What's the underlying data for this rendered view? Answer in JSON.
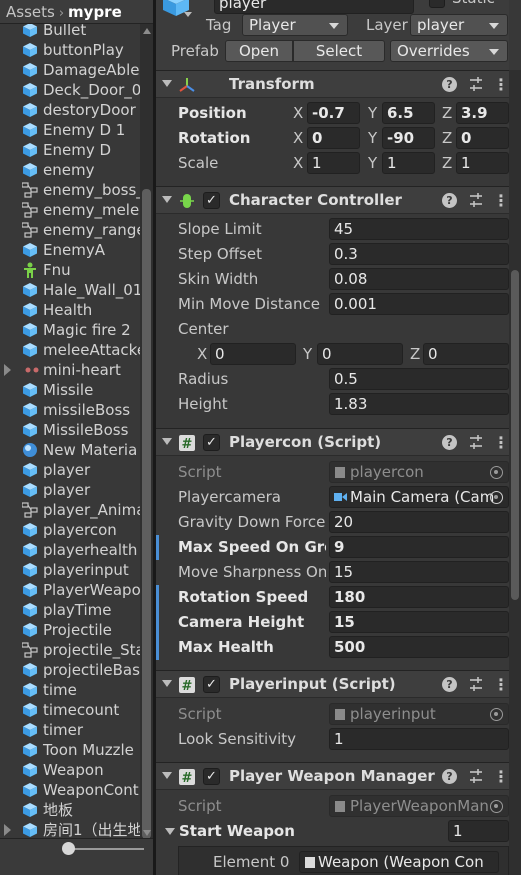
{
  "project": {
    "breadcrumb_root": "Assets",
    "breadcrumb_separator": "›",
    "breadcrumb_current": "mypre",
    "assets": [
      {
        "label": "Bullet",
        "icon": "prefab-icon"
      },
      {
        "label": "buttonPlay",
        "icon": "prefab-icon"
      },
      {
        "label": "DamageAble",
        "icon": "prefab-icon"
      },
      {
        "label": "Deck_Door_0",
        "icon": "prefab-icon"
      },
      {
        "label": "destoryDoor",
        "icon": "prefab-icon"
      },
      {
        "label": "Enemy D 1",
        "icon": "prefab-icon"
      },
      {
        "label": "Enemy D",
        "icon": "prefab-icon"
      },
      {
        "label": "enemy",
        "icon": "prefab-icon"
      },
      {
        "label": "enemy_boss_",
        "icon": "animator-icon"
      },
      {
        "label": "enemy_melee",
        "icon": "animator-icon"
      },
      {
        "label": "enemy_range",
        "icon": "animator-icon"
      },
      {
        "label": "EnemyA",
        "icon": "prefab-icon"
      },
      {
        "label": "Fnu",
        "icon": "avatar-mask-icon"
      },
      {
        "label": "Hale_Wall_01",
        "icon": "prefab-icon"
      },
      {
        "label": "Health",
        "icon": "prefab-icon"
      },
      {
        "label": "Magic fire 2",
        "icon": "prefab-icon"
      },
      {
        "label": "meleeAttacke",
        "icon": "prefab-icon"
      },
      {
        "label": "mini-heart",
        "icon": "heart-model-icon",
        "foldable": true
      },
      {
        "label": "Missile",
        "icon": "prefab-icon"
      },
      {
        "label": "missileBoss",
        "icon": "prefab-icon"
      },
      {
        "label": "MissileBoss",
        "icon": "prefab-icon"
      },
      {
        "label": "New Materia",
        "icon": "material-icon"
      },
      {
        "label": "player",
        "icon": "prefab-icon"
      },
      {
        "label": "player",
        "icon": "prefab-icon"
      },
      {
        "label": "player_Anima",
        "icon": "animator-icon"
      },
      {
        "label": "playercon",
        "icon": "prefab-icon"
      },
      {
        "label": "playerhealth",
        "icon": "prefab-icon"
      },
      {
        "label": "playerinput",
        "icon": "prefab-icon"
      },
      {
        "label": "PlayerWeapo",
        "icon": "prefab-icon"
      },
      {
        "label": "playTime",
        "icon": "prefab-icon"
      },
      {
        "label": "Projectile",
        "icon": "prefab-icon"
      },
      {
        "label": "projectile_Sta",
        "icon": "animator-icon"
      },
      {
        "label": "projectileBas",
        "icon": "prefab-icon"
      },
      {
        "label": "time",
        "icon": "prefab-icon"
      },
      {
        "label": "timecount",
        "icon": "prefab-icon"
      },
      {
        "label": "timer",
        "icon": "prefab-icon"
      },
      {
        "label": "Toon Muzzle",
        "icon": "prefab-icon"
      },
      {
        "label": "Weapon",
        "icon": "prefab-icon"
      },
      {
        "label": "WeaponCont",
        "icon": "prefab-icon"
      },
      {
        "label": "地板",
        "icon": "prefab-icon"
      },
      {
        "label": "房间1（出生地",
        "icon": "prefab-icon",
        "foldable": true
      }
    ]
  },
  "inspector": {
    "object_name": "player",
    "static_label": "Static",
    "tag_label": "Tag",
    "tag_value": "Player",
    "layer_label": "Layer",
    "layer_value": "player",
    "prefab_label": "Prefab",
    "open_button": "Open",
    "select_button": "Select",
    "overrides_button": "Overrides",
    "transform": {
      "title": "Transform",
      "position_label": "Position",
      "rotation_label": "Rotation",
      "scale_label": "Scale",
      "x": "X",
      "y": "Y",
      "z": "Z",
      "position": [
        "-0.7",
        "6.5",
        "3.9"
      ],
      "rotation": [
        "0",
        "-90",
        "0"
      ],
      "scale": [
        "1",
        "1",
        "1"
      ]
    },
    "character_controller": {
      "title": "Character Controller",
      "check": "✓",
      "slope_limit_label": "Slope Limit",
      "slope_limit": "45",
      "step_offset_label": "Step Offset",
      "step_offset": "0.3",
      "skin_width_label": "Skin Width",
      "skin_width": "0.08",
      "min_move_label": "Min Move Distance",
      "min_move": "0.001",
      "center_label": "Center",
      "center": [
        "0",
        "0",
        "0"
      ],
      "radius_label": "Radius",
      "radius": "0.5",
      "height_label": "Height",
      "height": "1.83"
    },
    "playercon": {
      "title": "Playercon (Script)",
      "check": "✓",
      "script_label": "Script",
      "script_value": "playercon",
      "camera_label": "Playercamera",
      "camera_value": "Main Camera (Cam",
      "gravity_label": "Gravity Down Force",
      "gravity": "20",
      "max_speed_label": "Max Speed On Grou",
      "max_speed": "9",
      "move_sharpness_label": "Move Sharpness On",
      "move_sharpness": "15",
      "rotation_speed_label": "Rotation Speed",
      "rotation_speed": "180",
      "camera_height_label": "Camera Height",
      "camera_height": "15",
      "max_health_label": "Max Health",
      "max_health": "500"
    },
    "playerinput": {
      "title": "Playerinput (Script)",
      "check": "✓",
      "script_label": "Script",
      "script_value": "playerinput",
      "look_label": "Look Sensitivity",
      "look": "1"
    },
    "weapon_manager": {
      "title": "Player Weapon Manager (Sc",
      "check": "✓",
      "script_label": "Script",
      "script_value": "PlayerWeaponMan",
      "start_weapon_label": "Start Weapon",
      "start_weapon_count": "1",
      "element_label": "Element 0",
      "element_value": "Weapon (Weapon Con"
    }
  }
}
